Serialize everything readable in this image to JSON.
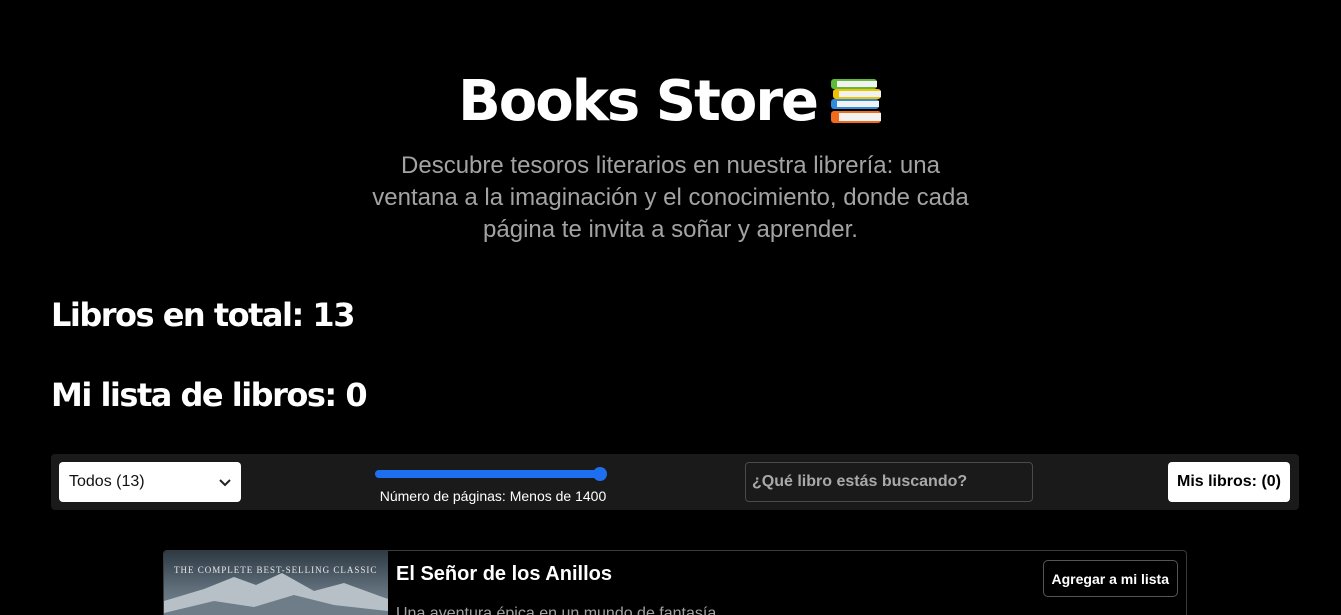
{
  "header": {
    "title": "Books Store",
    "subtitle": "Descubre tesoros literarios en nuestra librería: una ventana a la imaginación y el conocimiento, donde cada página te invita a soñar y aprender.",
    "icon": "books-stack-icon"
  },
  "stats": {
    "total_label": "Libros en total: 13",
    "mylist_label": "Mi lista de libros: 0"
  },
  "filters": {
    "genre_select": {
      "selected": "Todos (13)"
    },
    "pages_slider": {
      "label": "Número de páginas: Menos de 1400",
      "level": 0.98
    },
    "search": {
      "placeholder": "¿Qué libro estás buscando?"
    },
    "my_books_button": "Mis libros: (0)"
  },
  "books": [
    {
      "title": "El Señor de los Anillos",
      "description": "Una aventura épica en un mundo de fantasía",
      "cover_text": "THE COMPLETE BEST-SELLING CLASSIC",
      "add_button": "Agregar a mi lista"
    }
  ],
  "colors": {
    "background": "#000000",
    "toolbar": "#1a1a1a",
    "accent": "#1e6ff0",
    "muted_text": "#a3a3a3"
  }
}
